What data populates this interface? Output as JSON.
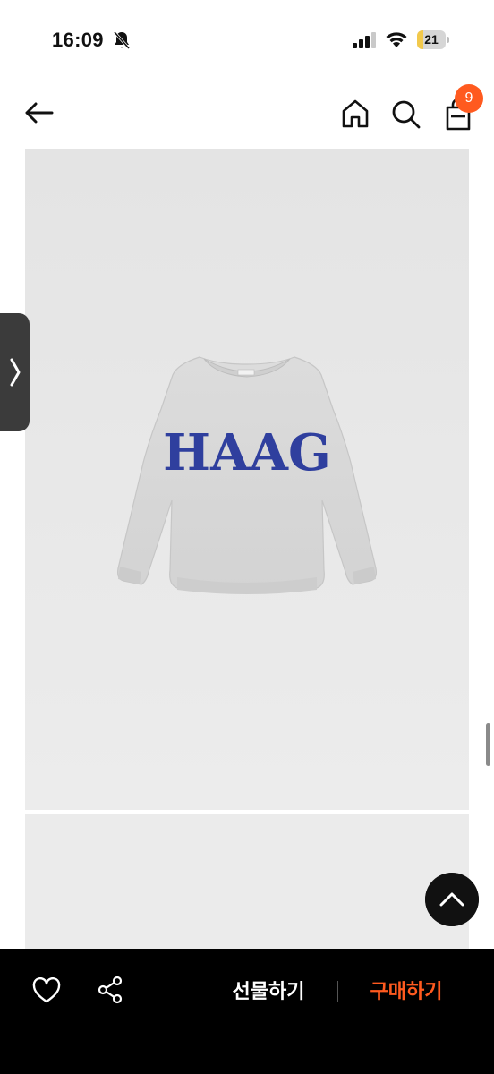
{
  "status_bar": {
    "time": "16:09",
    "battery_level": "21",
    "icons": [
      "bell-slash-icon",
      "signal-icon",
      "wifi-icon",
      "battery-icon"
    ]
  },
  "header": {
    "icons": [
      "back-arrow-icon",
      "home-icon",
      "search-icon",
      "shopping-bag-icon"
    ],
    "cart_count": "9"
  },
  "product": {
    "image_print_text": "HAAG"
  },
  "bottom_bar": {
    "gift_label": "선물하기",
    "buy_label": "구매하기",
    "icons": [
      "heart-icon",
      "share-icon"
    ]
  },
  "colors": {
    "accent": "#ff5a1f",
    "bottom_bar_bg": "#000000",
    "image_bg": "#e8e8e8",
    "print_blue": "#2f3f9e"
  }
}
